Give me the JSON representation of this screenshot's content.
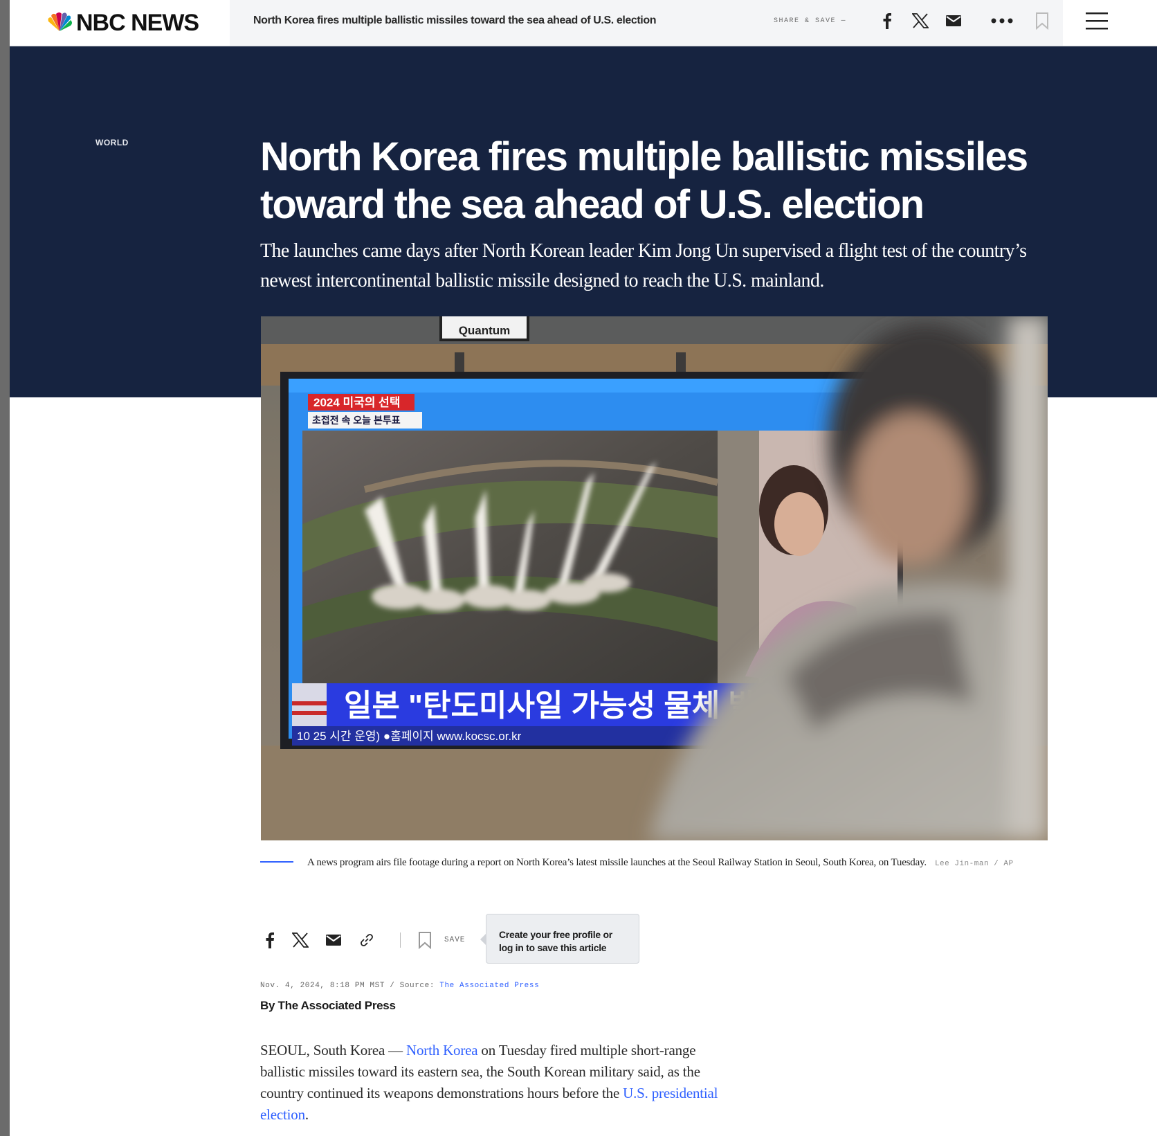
{
  "nav": {
    "logo": "NBC NEWS",
    "article_title": "North Korea fires multiple ballistic missiles toward the sea ahead of U.S. election",
    "share_save_label": "SHARE & SAVE —",
    "icons": [
      "facebook-icon",
      "x-icon",
      "email-icon",
      "more-icon",
      "bookmark-icon",
      "menu-icon"
    ]
  },
  "article": {
    "section": "WORLD",
    "headline": "North Korea fires multiple ballistic missiles toward the sea ahead of U.S. election",
    "dek": "The launches came days after North Korean leader Kim Jong Un supervised a flight test of the country’s newest intercontinental ballistic missile designed to reach the U.S. mainland.",
    "photo": {
      "store_sign": "Quantum",
      "tv_banner": "2024 미국의 선택",
      "tv_subbanner": "초접전 속 오늘 본투표",
      "tv_ticker": "일본 \"탄도미사일 가능성 물체 발",
      "tv_crawl": "10 25 시간 운영) ●홈페이지 www.kocsc.or.kr"
    },
    "caption": "A news program airs file footage during a report on North Korea’s latest missile launches at the Seoul Railway Station in Seoul, South Korea, on Tuesday.",
    "caption_credit": "Lee Jin-man / AP",
    "share": {
      "save_label": "SAVE",
      "tooltip": "Create your free profile or log in to save this article"
    },
    "date": "Nov. 4, 2024, 8:18 PM MST / Source: ",
    "source": "The Associated Press",
    "byline": "By The Associated Press",
    "body": {
      "p1_a": "SEOUL, South Korea — ",
      "p1_link1": "North Korea",
      "p1_b": " on Tuesday fired multiple short-range ballistic missiles toward its eastern sea, the South Korean military said, as the country continued its weapons demonstrations hours before the ",
      "p1_link2": "U.S. presidential election",
      "p1_c": "."
    }
  },
  "colors": {
    "hero_bg": "#162340",
    "link_blue": "#3061ff",
    "nav_bg": "#f4f5f7"
  }
}
